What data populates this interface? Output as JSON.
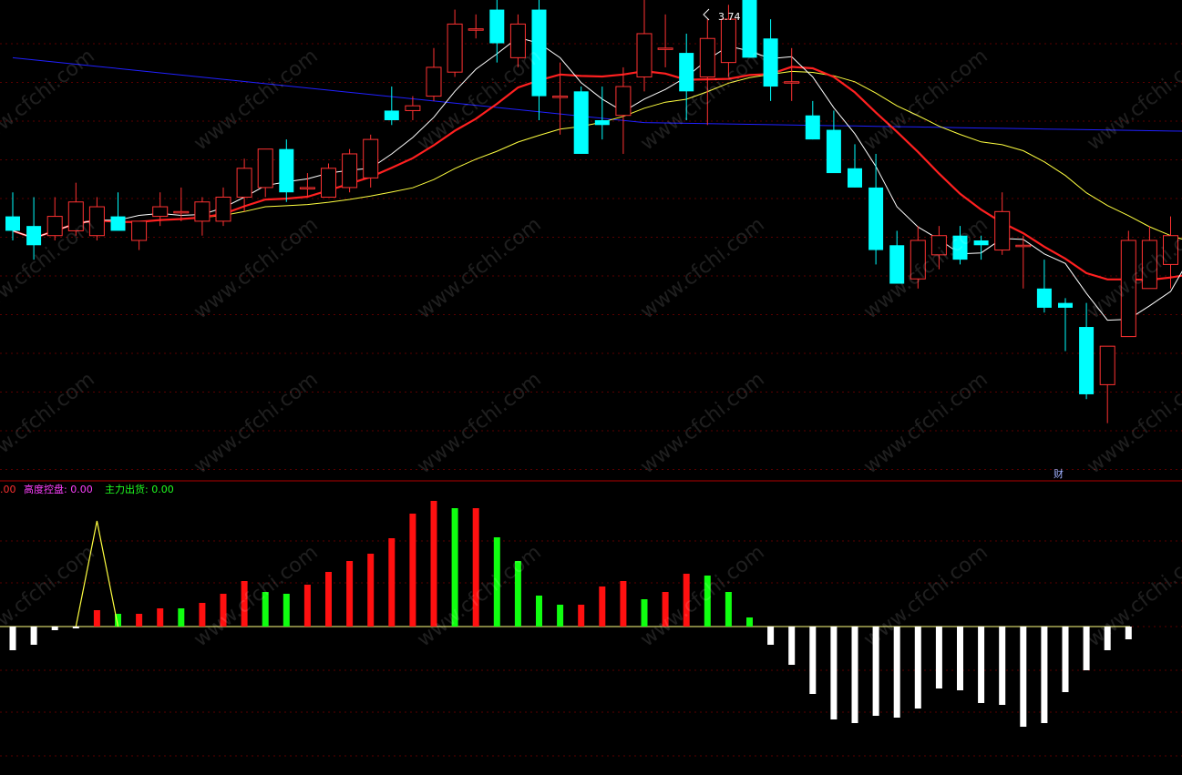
{
  "chart_data": {
    "type": "candlestick",
    "annotations": {
      "high_marker": "3.74",
      "fin_marker": "财"
    },
    "watermark": "www.cfchi.com",
    "colors": {
      "up": "#ff3232",
      "down": "#00ffff",
      "ma5": "#ffffff",
      "ma10": "#ff2020",
      "ma20": "#ffff40",
      "ma60": "#2020ff",
      "grid": "#5a0000",
      "bar_red": "#ff1010",
      "bar_green": "#10ff10",
      "bar_white": "#ffffff",
      "spike": "#ffff40"
    },
    "indicator": {
      "legend": [
        {
          "label": ".00",
          "color": "#ff3030"
        },
        {
          "label": "高度控盘: 0.00",
          "color": "#ff40ff"
        },
        {
          "label": "主力出货: 0.00",
          "color": "#20ff20"
        }
      ],
      "bars": [
        {
          "v": -26,
          "c": "white"
        },
        {
          "v": -20,
          "c": "white"
        },
        {
          "v": -4,
          "c": "white"
        },
        {
          "v": -2,
          "c": "white"
        },
        {
          "v": 18,
          "c": "red"
        },
        {
          "v": 14,
          "c": "green"
        },
        {
          "v": 14,
          "c": "red"
        },
        {
          "v": 20,
          "c": "red"
        },
        {
          "v": 20,
          "c": "green"
        },
        {
          "v": 26,
          "c": "red"
        },
        {
          "v": 36,
          "c": "red"
        },
        {
          "v": 50,
          "c": "red"
        },
        {
          "v": 38,
          "c": "green"
        },
        {
          "v": 36,
          "c": "green"
        },
        {
          "v": 46,
          "c": "red"
        },
        {
          "v": 60,
          "c": "red"
        },
        {
          "v": 72,
          "c": "red"
        },
        {
          "v": 80,
          "c": "red"
        },
        {
          "v": 97,
          "c": "red"
        },
        {
          "v": 124,
          "c": "red"
        },
        {
          "v": 138,
          "c": "red"
        },
        {
          "v": 130,
          "c": "green"
        },
        {
          "v": 130,
          "c": "red"
        },
        {
          "v": 98,
          "c": "green"
        },
        {
          "v": 72,
          "c": "green"
        },
        {
          "v": 34,
          "c": "green"
        },
        {
          "v": 24,
          "c": "green"
        },
        {
          "v": 24,
          "c": "red"
        },
        {
          "v": 44,
          "c": "red"
        },
        {
          "v": 50,
          "c": "red"
        },
        {
          "v": 30,
          "c": "green"
        },
        {
          "v": 38,
          "c": "red"
        },
        {
          "v": 58,
          "c": "red"
        },
        {
          "v": 56,
          "c": "green"
        },
        {
          "v": 38,
          "c": "green"
        },
        {
          "v": 10,
          "c": "green"
        },
        {
          "v": -20,
          "c": "white"
        },
        {
          "v": -42,
          "c": "white"
        },
        {
          "v": -74,
          "c": "white"
        },
        {
          "v": -102,
          "c": "white"
        },
        {
          "v": -106,
          "c": "white"
        },
        {
          "v": -98,
          "c": "white"
        },
        {
          "v": -100,
          "c": "white"
        },
        {
          "v": -90,
          "c": "white"
        },
        {
          "v": -68,
          "c": "white"
        },
        {
          "v": -70,
          "c": "white"
        },
        {
          "v": -84,
          "c": "white"
        },
        {
          "v": -86,
          "c": "white"
        },
        {
          "v": -110,
          "c": "white"
        },
        {
          "v": -106,
          "c": "white"
        },
        {
          "v": -72,
          "c": "white"
        },
        {
          "v": -48,
          "c": "white"
        },
        {
          "v": -26,
          "c": "white"
        },
        {
          "v": -14,
          "c": "white"
        }
      ],
      "spike": [
        [
          3,
          0
        ],
        [
          4,
          116
        ],
        [
          5,
          0
        ]
      ],
      "ylim": [
        -120,
        140
      ]
    },
    "ylim": [
      0,
      100
    ],
    "candles": [
      {
        "o": 55,
        "h": 60,
        "l": 50,
        "c": 52
      },
      {
        "o": 53,
        "h": 59,
        "l": 46,
        "c": 49
      },
      {
        "o": 51,
        "h": 59,
        "l": 50,
        "c": 55
      },
      {
        "o": 52,
        "h": 62,
        "l": 51,
        "c": 58
      },
      {
        "o": 51,
        "h": 59,
        "l": 50,
        "c": 57
      },
      {
        "o": 55,
        "h": 60,
        "l": 53,
        "c": 52
      },
      {
        "o": 50,
        "h": 54,
        "l": 48,
        "c": 54
      },
      {
        "o": 55,
        "h": 60,
        "l": 53,
        "c": 57
      },
      {
        "o": 56,
        "h": 61,
        "l": 54,
        "c": 56
      },
      {
        "o": 54,
        "h": 59,
        "l": 51,
        "c": 58
      },
      {
        "o": 54,
        "h": 61,
        "l": 53,
        "c": 59
      },
      {
        "o": 59,
        "h": 67,
        "l": 56,
        "c": 65
      },
      {
        "o": 61,
        "h": 68,
        "l": 59,
        "c": 69
      },
      {
        "o": 69,
        "h": 71,
        "l": 58,
        "c": 60
      },
      {
        "o": 61,
        "h": 64,
        "l": 59,
        "c": 61
      },
      {
        "o": 59,
        "h": 66,
        "l": 60,
        "c": 65
      },
      {
        "o": 61,
        "h": 69,
        "l": 60,
        "c": 68
      },
      {
        "o": 63,
        "h": 72,
        "l": 61,
        "c": 71
      },
      {
        "o": 77,
        "h": 82,
        "l": 74,
        "c": 75
      },
      {
        "o": 77,
        "h": 80,
        "l": 75,
        "c": 78
      },
      {
        "o": 80,
        "h": 90,
        "l": 79,
        "c": 86
      },
      {
        "o": 85,
        "h": 98,
        "l": 84,
        "c": 95
      },
      {
        "o": 94,
        "h": 97,
        "l": 92,
        "c": 94
      },
      {
        "o": 98,
        "h": 111,
        "l": 87,
        "c": 91
      },
      {
        "o": 88,
        "h": 97,
        "l": 86,
        "c": 95
      },
      {
        "o": 98,
        "h": 100,
        "l": 75,
        "c": 80
      },
      {
        "o": 80,
        "h": 87,
        "l": 72,
        "c": 80
      },
      {
        "o": 81,
        "h": 82,
        "l": 68,
        "c": 68
      },
      {
        "o": 75,
        "h": 82,
        "l": 71,
        "c": 74
      },
      {
        "o": 76,
        "h": 86,
        "l": 68,
        "c": 82
      },
      {
        "o": 84,
        "h": 103,
        "l": 81,
        "c": 93
      },
      {
        "o": 90,
        "h": 97,
        "l": 86,
        "c": 90
      },
      {
        "o": 89,
        "h": 93,
        "l": 75,
        "c": 81
      },
      {
        "o": 84,
        "h": 96,
        "l": 74,
        "c": 92
      },
      {
        "o": 87,
        "h": 99,
        "l": 84,
        "c": 96
      },
      {
        "o": 104,
        "h": 110,
        "l": 92,
        "c": 88
      },
      {
        "o": 92,
        "h": 96,
        "l": 79,
        "c": 82
      },
      {
        "o": 83,
        "h": 90,
        "l": 79,
        "c": 83
      },
      {
        "o": 76,
        "h": 79,
        "l": 71,
        "c": 71
      },
      {
        "o": 73,
        "h": 77,
        "l": 66,
        "c": 64
      },
      {
        "o": 65,
        "h": 70,
        "l": 61,
        "c": 61
      },
      {
        "o": 61,
        "h": 68,
        "l": 45,
        "c": 48
      },
      {
        "o": 49,
        "h": 52,
        "l": 42,
        "c": 41
      },
      {
        "o": 42,
        "h": 53,
        "l": 40,
        "c": 50
      },
      {
        "o": 47,
        "h": 53,
        "l": 44,
        "c": 51
      },
      {
        "o": 51,
        "h": 53,
        "l": 45,
        "c": 46
      },
      {
        "o": 50,
        "h": 51,
        "l": 46,
        "c": 49
      },
      {
        "o": 48,
        "h": 60,
        "l": 47,
        "c": 56
      },
      {
        "o": 49,
        "h": 51,
        "l": 40,
        "c": 49
      },
      {
        "o": 40,
        "h": 46,
        "l": 35,
        "c": 36
      },
      {
        "o": 37,
        "h": 38,
        "l": 27,
        "c": 36
      },
      {
        "o": 32,
        "h": 37,
        "l": 17,
        "c": 18
      },
      {
        "o": 20,
        "h": 28,
        "l": 12,
        "c": 28
      },
      {
        "o": 30,
        "h": 52,
        "l": 30,
        "c": 50
      },
      {
        "o": 40,
        "h": 53,
        "l": 40,
        "c": 50
      },
      {
        "o": 45,
        "h": 55,
        "l": 40,
        "c": 51
      },
      {
        "o": 49,
        "h": 58,
        "l": 47,
        "c": 56
      }
    ]
  }
}
